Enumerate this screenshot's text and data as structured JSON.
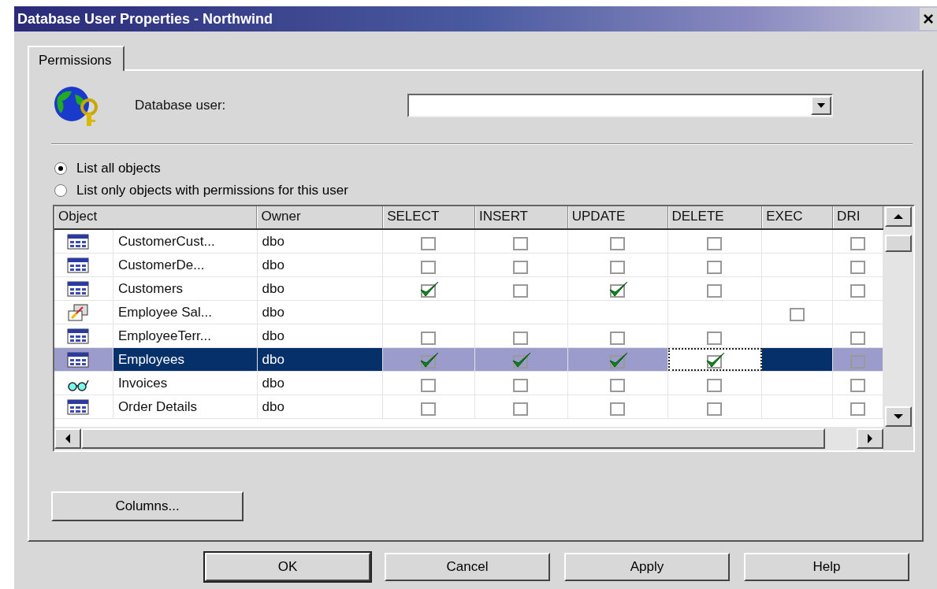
{
  "window": {
    "title": "Database User Properties - Northwind",
    "close": "×"
  },
  "tabs": [
    {
      "label": "Permissions",
      "selected": true
    }
  ],
  "user_field": {
    "label": "Database user:"
  },
  "list_options": [
    {
      "label": "List all objects",
      "selected": true
    },
    {
      "label": "List only objects with permissions for this user",
      "selected": false
    }
  ],
  "table": {
    "columns": [
      "Object",
      "Owner",
      "SELECT",
      "INSERT",
      "UPDATE",
      "DELETE",
      "EXEC",
      "DRI"
    ],
    "rows": [
      {
        "kind": "table",
        "name": "CustomerCust...",
        "owner": "dbo",
        "selected": false,
        "perms": [
          {
            "kind": "checkbox",
            "checked": false
          },
          {
            "kind": "checkbox",
            "checked": false
          },
          {
            "kind": "checkbox",
            "checked": false
          },
          {
            "kind": "checkbox",
            "checked": false
          },
          {
            "kind": "empty"
          },
          {
            "kind": "checkbox",
            "checked": false
          }
        ]
      },
      {
        "kind": "table",
        "name": "CustomerDe...",
        "owner": "dbo",
        "selected": false,
        "perms": [
          {
            "kind": "checkbox",
            "checked": false
          },
          {
            "kind": "checkbox",
            "checked": false
          },
          {
            "kind": "checkbox",
            "checked": false
          },
          {
            "kind": "checkbox",
            "checked": false
          },
          {
            "kind": "empty"
          },
          {
            "kind": "checkbox",
            "checked": false
          }
        ]
      },
      {
        "kind": "table",
        "name": "Customers",
        "owner": "dbo",
        "selected": false,
        "perms": [
          {
            "kind": "checkbox",
            "checked": true
          },
          {
            "kind": "checkbox",
            "checked": false
          },
          {
            "kind": "checkbox",
            "checked": true
          },
          {
            "kind": "checkbox",
            "checked": false
          },
          {
            "kind": "empty"
          },
          {
            "kind": "checkbox",
            "checked": false
          }
        ]
      },
      {
        "kind": "procedure",
        "name": "Employee Sal...",
        "owner": "dbo",
        "selected": false,
        "perms": [
          {
            "kind": "empty"
          },
          {
            "kind": "empty"
          },
          {
            "kind": "empty"
          },
          {
            "kind": "empty"
          },
          {
            "kind": "checkbox",
            "checked": false
          },
          {
            "kind": "empty"
          }
        ]
      },
      {
        "kind": "table",
        "name": "EmployeeTerr...",
        "owner": "dbo",
        "selected": false,
        "perms": [
          {
            "kind": "checkbox",
            "checked": false
          },
          {
            "kind": "checkbox",
            "checked": false
          },
          {
            "kind": "checkbox",
            "checked": false
          },
          {
            "kind": "checkbox",
            "checked": false
          },
          {
            "kind": "empty"
          },
          {
            "kind": "checkbox",
            "checked": false
          }
        ]
      },
      {
        "kind": "table",
        "name": "Employees",
        "owner": "dbo",
        "selected": true,
        "perms": [
          {
            "kind": "checkbox",
            "checked": true
          },
          {
            "kind": "checkbox",
            "checked": true
          },
          {
            "kind": "checkbox",
            "checked": true
          },
          {
            "kind": "checkbox",
            "checked": true,
            "focused": true
          },
          {
            "kind": "empty"
          },
          {
            "kind": "checkbox",
            "checked": false
          }
        ]
      },
      {
        "kind": "view",
        "name": "Invoices",
        "owner": "dbo",
        "selected": false,
        "perms": [
          {
            "kind": "checkbox",
            "checked": false
          },
          {
            "kind": "checkbox",
            "checked": false
          },
          {
            "kind": "checkbox",
            "checked": false
          },
          {
            "kind": "checkbox",
            "checked": false
          },
          {
            "kind": "empty"
          },
          {
            "kind": "checkbox",
            "checked": false
          }
        ]
      },
      {
        "kind": "table",
        "name": "Order Details",
        "owner": "dbo",
        "selected": false,
        "perms": [
          {
            "kind": "checkbox",
            "checked": false
          },
          {
            "kind": "checkbox",
            "checked": false
          },
          {
            "kind": "checkbox",
            "checked": false
          },
          {
            "kind": "checkbox",
            "checked": false
          },
          {
            "kind": "empty"
          },
          {
            "kind": "checkbox",
            "checked": false
          }
        ]
      }
    ]
  },
  "buttons": {
    "columns": "Columns...",
    "footer": [
      "OK",
      "Cancel",
      "Apply",
      "Help"
    ]
  }
}
